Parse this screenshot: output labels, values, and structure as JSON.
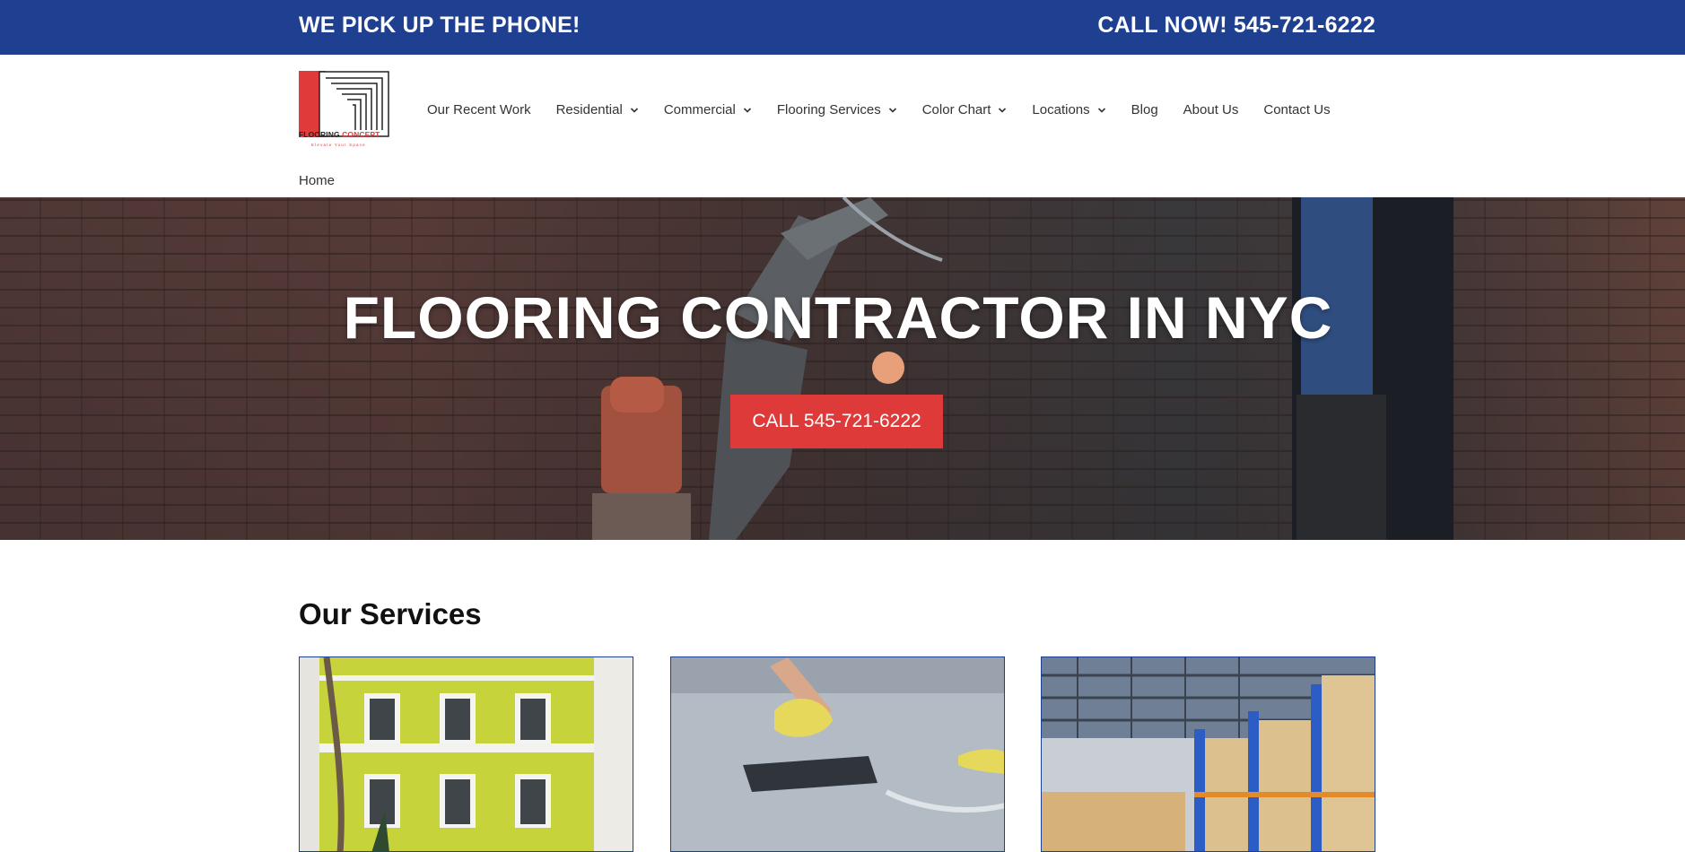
{
  "topbar": {
    "left_text": "WE PICK UP THE PHONE!",
    "right_text": "CALL NOW! 545-721-6222"
  },
  "logo": {
    "brand_dark": "FLOORING",
    "brand_accent": "CONCEPT",
    "tagline": "Elevate Your Space"
  },
  "nav": {
    "items": [
      {
        "label": "Our Recent Work",
        "dropdown": false
      },
      {
        "label": "Residential",
        "dropdown": true
      },
      {
        "label": "Commercial",
        "dropdown": true
      },
      {
        "label": "Flooring Services",
        "dropdown": true
      },
      {
        "label": "Color Chart",
        "dropdown": true
      },
      {
        "label": "Locations",
        "dropdown": true
      },
      {
        "label": "Blog",
        "dropdown": false
      },
      {
        "label": "About Us",
        "dropdown": false
      },
      {
        "label": "Contact Us",
        "dropdown": false
      }
    ]
  },
  "breadcrumb": {
    "home": "Home"
  },
  "hero": {
    "title": "FLOORING CONTRACTOR IN NYC",
    "cta_label": "CALL 545-721-6222"
  },
  "services": {
    "title": "Our Services"
  },
  "colors": {
    "brand_blue": "#1f3f91",
    "brand_red": "#df3a3a"
  }
}
